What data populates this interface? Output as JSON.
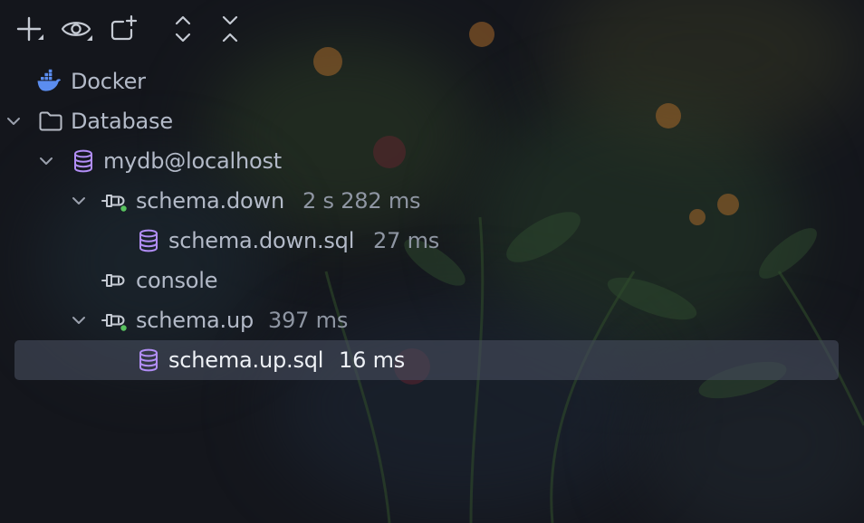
{
  "toolbar": {
    "buttons": [
      {
        "name": "add-button",
        "icon": "plus-icon"
      },
      {
        "name": "view-button",
        "icon": "eye-icon"
      },
      {
        "name": "new-query-console-button",
        "icon": "new-console-icon"
      },
      {
        "name": "expand-all-button",
        "icon": "expand-all-icon"
      },
      {
        "name": "collapse-all-button",
        "icon": "collapse-all-icon"
      }
    ]
  },
  "tree": {
    "items": [
      {
        "label": "Docker",
        "time": "",
        "icon": "docker-icon",
        "expanded": null,
        "status_dot": false,
        "selected": false
      },
      {
        "label": "Database",
        "time": "",
        "icon": "folder-icon",
        "expanded": true,
        "status_dot": false,
        "selected": false
      },
      {
        "label": "mydb@localhost",
        "time": "",
        "icon": "database-icon",
        "expanded": true,
        "status_dot": false,
        "selected": false
      },
      {
        "label": "schema.down",
        "time": "2 s 282 ms",
        "icon": "session-plug-icon",
        "expanded": true,
        "status_dot": true,
        "selected": false
      },
      {
        "label": "schema.down.sql",
        "time": "27 ms",
        "icon": "database-icon",
        "expanded": null,
        "status_dot": false,
        "selected": false
      },
      {
        "label": "console",
        "time": "",
        "icon": "session-plug-icon",
        "expanded": null,
        "status_dot": false,
        "selected": false
      },
      {
        "label": "schema.up",
        "time": "397 ms",
        "icon": "session-plug-icon",
        "expanded": true,
        "status_dot": true,
        "selected": false
      },
      {
        "label": "schema.up.sql",
        "time": "16 ms",
        "icon": "database-icon",
        "expanded": null,
        "status_dot": false,
        "selected": true
      }
    ]
  },
  "colors": {
    "docker": "#5b8def",
    "database_icon": "#b28ef7",
    "status_dot": "#58c25f",
    "text": "#b3bac8",
    "time_text": "#8f96a3",
    "selection": "#3f4452"
  }
}
